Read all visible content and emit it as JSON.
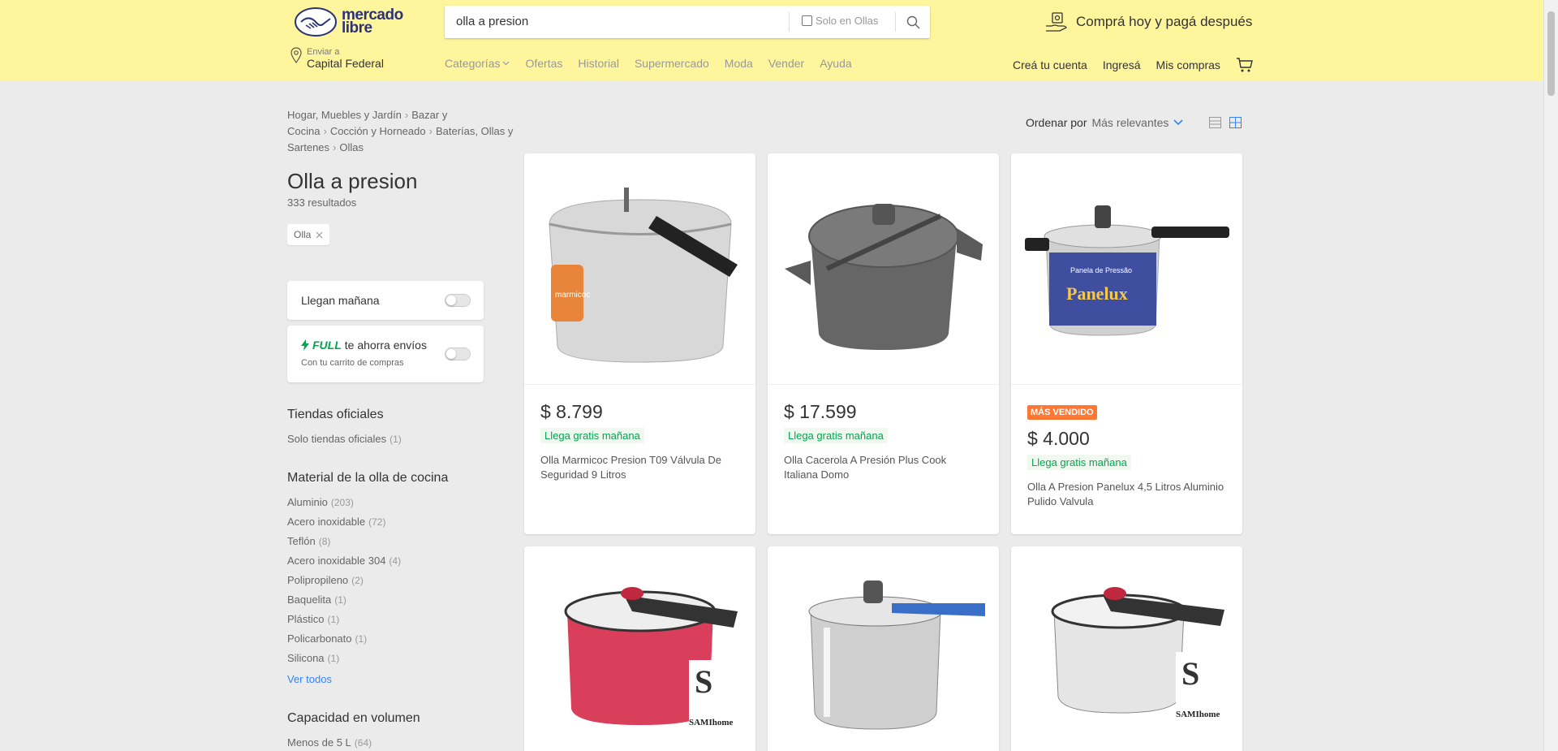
{
  "header": {
    "logo_line1": "mercado",
    "logo_line2": "libre",
    "search_value": "olla a presion",
    "only_in_label": "Solo en Ollas",
    "promo_text": "Comprá hoy y pagá después",
    "location_label": "Enviar a",
    "location_value": "Capital Federal",
    "nav": [
      "Categorías",
      "Ofertas",
      "Historial",
      "Supermercado",
      "Moda",
      "Vender",
      "Ayuda"
    ],
    "account": [
      "Creá tu cuenta",
      "Ingresá",
      "Mis compras"
    ]
  },
  "breadcrumb": [
    "Hogar, Muebles y Jardín",
    "Bazar y Cocina",
    "Cocción y Horneado",
    "Baterías, Ollas y Sartenes",
    "Ollas"
  ],
  "page": {
    "title": "Olla a presion",
    "results": "333 resultados",
    "chip": "Olla"
  },
  "filters": {
    "toggle1": "Llegan mañana",
    "full_brand": "FULL",
    "full_text": "te ahorra envíos",
    "full_sub": "Con tu carrito de compras",
    "official_title": "Tiendas oficiales",
    "official_item": "Solo tiendas oficiales",
    "official_count": "(1)",
    "material_title": "Material de la olla de cocina",
    "materials": [
      {
        "label": "Aluminio",
        "count": "(203)"
      },
      {
        "label": "Acero inoxidable",
        "count": "(72)"
      },
      {
        "label": "Teflón",
        "count": "(8)"
      },
      {
        "label": "Acero inoxidable 304",
        "count": "(4)"
      },
      {
        "label": "Polipropileno",
        "count": "(2)"
      },
      {
        "label": "Baquelita",
        "count": "(1)"
      },
      {
        "label": "Plástico",
        "count": "(1)"
      },
      {
        "label": "Policarbonato",
        "count": "(1)"
      },
      {
        "label": "Silicona",
        "count": "(1)"
      }
    ],
    "see_all": "Ver todos",
    "capacity_title": "Capacidad en volumen",
    "capacity_first": "Menos de 5 L",
    "capacity_first_count": "(64)"
  },
  "sort": {
    "label": "Ordenar por",
    "value": "Más relevantes"
  },
  "products": [
    {
      "price": "$ 8.799",
      "shipping": "Llega gratis mañana",
      "title": "Olla Marmicoc Presion T09 Válvula De Seguridad 9 Litros",
      "badge": ""
    },
    {
      "price": "$ 17.599",
      "shipping": "Llega gratis mañana",
      "title": "Olla Cacerola A Presión Plus Cook Italiana Domo",
      "badge": ""
    },
    {
      "price": "$ 4.000",
      "shipping": "Llega gratis mañana",
      "title": "Olla A Presion Panelux 4,5 Litros Aluminio Pulido Valvula",
      "badge": "MÁS VENDIDO"
    }
  ],
  "image_text": {
    "panelux": "Panelux",
    "panela": "Panela de Pressão",
    "marmicoc": "marmicoc",
    "samihome": "SAMIhome"
  }
}
